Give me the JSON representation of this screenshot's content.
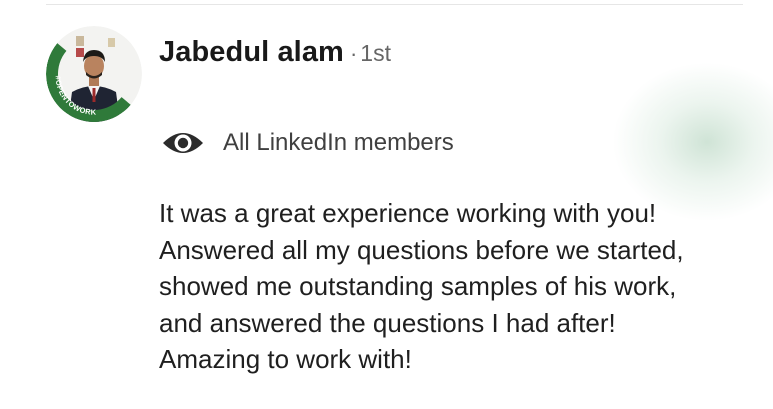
{
  "recommendation": {
    "author_name": "Jabedul alam",
    "separator": "·",
    "connection_degree": "1st",
    "avatar_badge_text": "#OPENTOWORK",
    "visibility": {
      "icon": "eye-icon",
      "label": "All LinkedIn members"
    },
    "text_lines": [
      "It was a great experience working with you!",
      "Answered all my questions before we started,",
      "showed me outstanding samples of his work,",
      "and answered the questions I had after!",
      "Amazing to work with!"
    ]
  },
  "colors": {
    "open_to_work_green": "#2f7a3a",
    "text_primary": "#191919",
    "text_secondary": "#666666"
  }
}
